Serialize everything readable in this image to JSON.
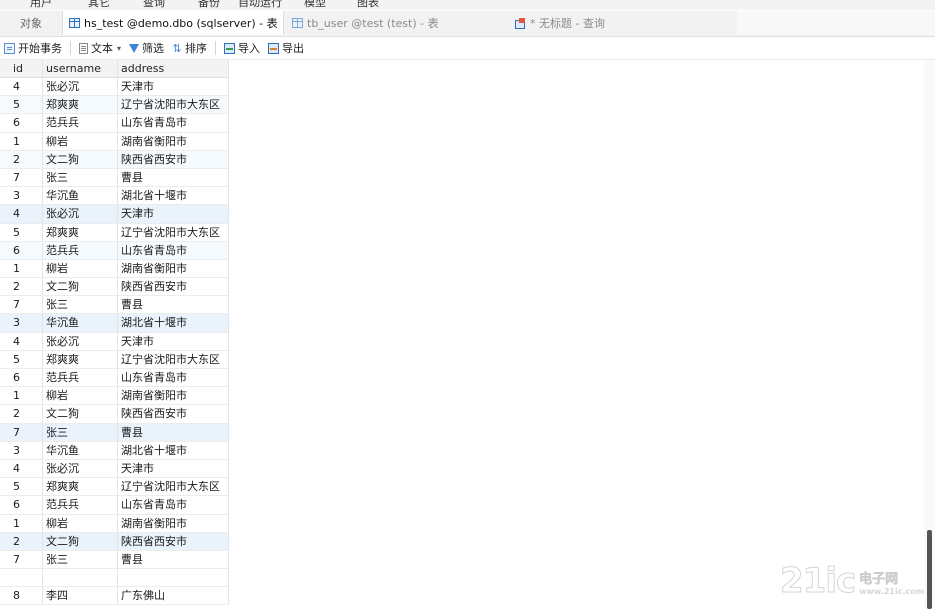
{
  "menu": [
    "用户",
    "其它",
    "查询",
    "备份",
    "自动运行",
    "模型",
    "图表"
  ],
  "tabs": {
    "objects": "对象",
    "active": "hs_test @demo.dbo (sqlserver) - 表",
    "tab2": "tb_user @test (test) - 表",
    "tab3": "* 无标题 - 查询"
  },
  "toolbar": {
    "begin_transaction": "开始事务",
    "text": "文本",
    "filter": "筛选",
    "sort": "排序",
    "import": "导入",
    "export": "导出"
  },
  "columns": [
    "id",
    "username",
    "address"
  ],
  "rows": [
    [
      "4",
      "张必沉",
      "天津市"
    ],
    [
      "5",
      "郑爽爽",
      "辽宁省沈阳市大东区"
    ],
    [
      "6",
      "范兵兵",
      "山东省青岛市"
    ],
    [
      "1",
      "柳岩",
      "湖南省衡阳市"
    ],
    [
      "2",
      "文二狗",
      "陕西省西安市"
    ],
    [
      "7",
      "张三",
      "曹县"
    ],
    [
      "3",
      "华沉鱼",
      "湖北省十堰市"
    ],
    [
      "4",
      "张必沉",
      "天津市"
    ],
    [
      "5",
      "郑爽爽",
      "辽宁省沈阳市大东区"
    ],
    [
      "6",
      "范兵兵",
      "山东省青岛市"
    ],
    [
      "1",
      "柳岩",
      "湖南省衡阳市"
    ],
    [
      "2",
      "文二狗",
      "陕西省西安市"
    ],
    [
      "7",
      "张三",
      "曹县"
    ],
    [
      "3",
      "华沉鱼",
      "湖北省十堰市"
    ],
    [
      "4",
      "张必沉",
      "天津市"
    ],
    [
      "5",
      "郑爽爽",
      "辽宁省沈阳市大东区"
    ],
    [
      "6",
      "范兵兵",
      "山东省青岛市"
    ],
    [
      "1",
      "柳岩",
      "湖南省衡阳市"
    ],
    [
      "2",
      "文二狗",
      "陕西省西安市"
    ],
    [
      "7",
      "张三",
      "曹县"
    ],
    [
      "3",
      "华沉鱼",
      "湖北省十堰市"
    ],
    [
      "4",
      "张必沉",
      "天津市"
    ],
    [
      "5",
      "郑爽爽",
      "辽宁省沈阳市大东区"
    ],
    [
      "6",
      "范兵兵",
      "山东省青岛市"
    ],
    [
      "1",
      "柳岩",
      "湖南省衡阳市"
    ],
    [
      "2",
      "文二狗",
      "陕西省西安市"
    ],
    [
      "7",
      "张三",
      "曹县"
    ],
    [
      "",
      "",
      ""
    ],
    [
      "8",
      "李四",
      "广东佛山"
    ]
  ],
  "watermark": {
    "logo": "21ic",
    "cn": "电子网",
    "site": "www.21ic.com"
  },
  "colors": {
    "accent": "#3b84d8",
    "selected_row": "#eaf2fc"
  }
}
